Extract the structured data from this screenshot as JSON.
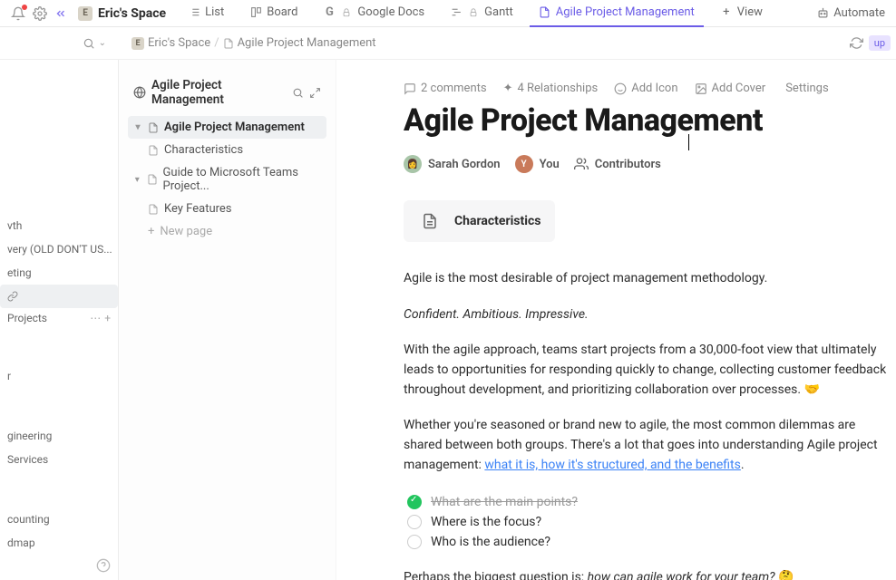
{
  "workspace": {
    "badge": "E",
    "title": "Eric's Space"
  },
  "tabs": [
    {
      "id": "list",
      "label": "List",
      "icon": "list-icon"
    },
    {
      "id": "board",
      "label": "Board",
      "icon": "board-icon"
    },
    {
      "id": "gdocs",
      "label": "Google Docs",
      "icon": "google-icon"
    },
    {
      "id": "gantt",
      "label": "Gantt",
      "icon": "gantt-icon"
    },
    {
      "id": "apm",
      "label": "Agile Project Management",
      "icon": "doc-icon",
      "active": true
    },
    {
      "id": "view",
      "label": "View",
      "icon": "plus-icon"
    }
  ],
  "topright": {
    "automate": "Automate"
  },
  "breadcrumb": {
    "space": "Eric's Space",
    "page": "Agile Project Management",
    "up": "up"
  },
  "farLeft": {
    "items_a": [
      "vth",
      "very (OLD DON'T US...",
      "eting",
      ""
    ],
    "projects_label": "Projects",
    "items_b": [
      "r",
      "gineering",
      "Services"
    ],
    "items_c": [
      "counting",
      "dmap"
    ]
  },
  "outline": {
    "title": "Agile Project Management",
    "tree": [
      {
        "label": "Agile Project Management",
        "level": 0,
        "selected": true,
        "expandable": true
      },
      {
        "label": "Characteristics",
        "level": 1
      },
      {
        "label": "Guide to Microsoft Teams Project...",
        "level": 0,
        "expandable": true
      },
      {
        "label": "Key Features",
        "level": 1
      }
    ],
    "newpage": "New page"
  },
  "docActions": {
    "comments": "2 comments",
    "relationships": "4  Relationships",
    "addIcon": "Add Icon",
    "addCover": "Add Cover",
    "settings": "Settings"
  },
  "document": {
    "title": "Agile Project Management",
    "people": {
      "p1": "Sarah Gordon",
      "p2": "You",
      "p3": "Contributors"
    },
    "section": {
      "title": "Characteristics"
    },
    "para1": "Agile is the most desirable of project management methodology.",
    "para2": "Confident. Ambitious. Impressive.",
    "para3a": "With the agile approach, teams start projects from a 30,000-foot view that ultimately leads to opportunities for responding quickly to change, collecting customer feedback throughout development, and prioritizing collaboration over processes. ",
    "para3_emoji": "🤝",
    "para4a": "Whether you're seasoned or brand new to agile, the most common dilemmas are shared between both groups. There's a lot that goes into understanding Agile project management: ",
    "para4_link": "what it is, how it's structured, and the benefits",
    "para4b": ".",
    "checklist": [
      {
        "text": "What are the main points?",
        "done": true
      },
      {
        "text": "Where is the focus?",
        "done": false
      },
      {
        "text": "Who is the audience?",
        "done": false
      }
    ],
    "para5a": "Perhaps the biggest question is: ",
    "para5_em": "how can agile work for your team?",
    "para5_emoji": "🤔"
  }
}
